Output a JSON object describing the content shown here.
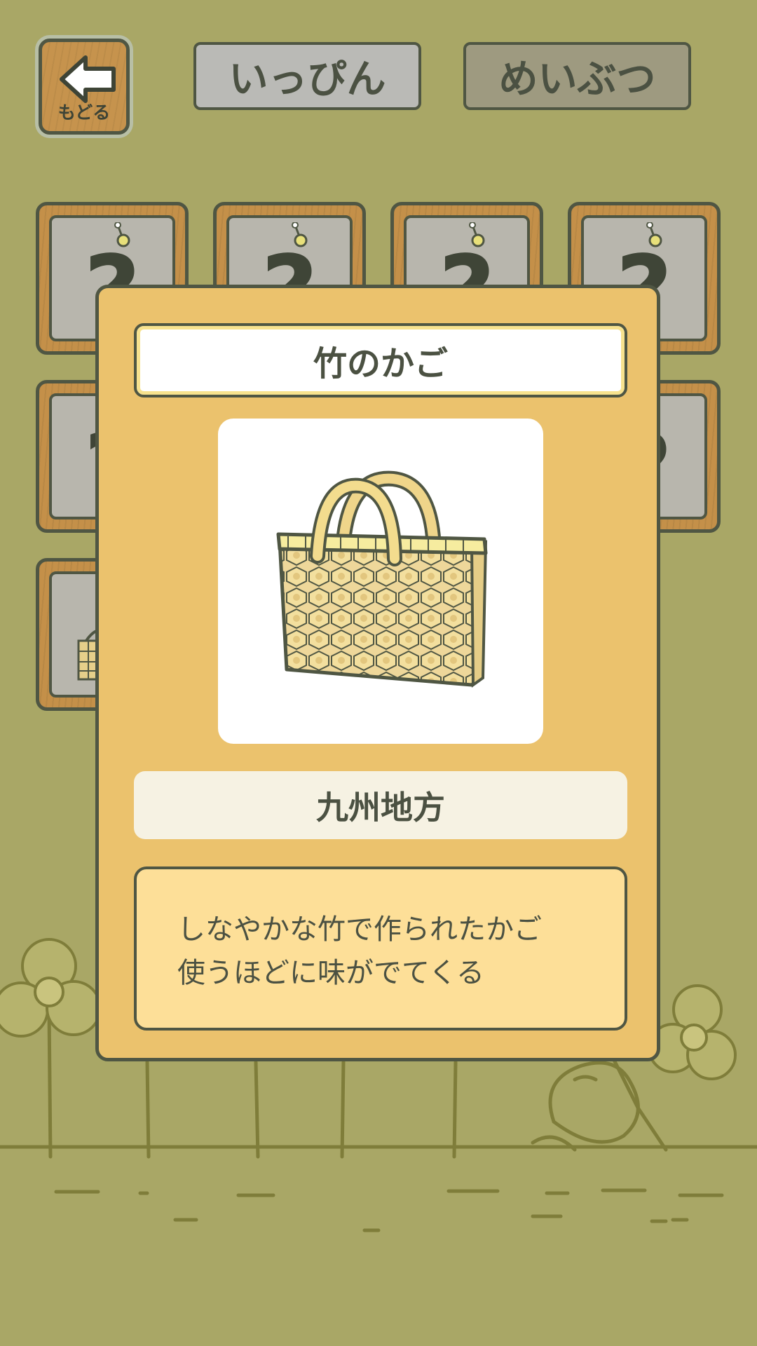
{
  "header": {
    "back_label": "もどる",
    "back_icon": "left-arrow-icon",
    "tabs": [
      {
        "label": "いっぴん",
        "selected": false
      },
      {
        "label": "めいぶつ",
        "selected": true
      }
    ]
  },
  "grid": {
    "locked_symbol": "?",
    "locked_icon": "question-mark-icon"
  },
  "modal": {
    "item_name": "竹のかご",
    "item_image": "bamboo-basket-icon",
    "region": "九州地方",
    "description": [
      "しなやかな竹で作られたかご",
      "使うほどに味がでてくる"
    ]
  },
  "colors": {
    "background": "#a9a766",
    "modal": "#ebc26d",
    "description_bg": "#fddf98",
    "outline": "#4f5643"
  }
}
